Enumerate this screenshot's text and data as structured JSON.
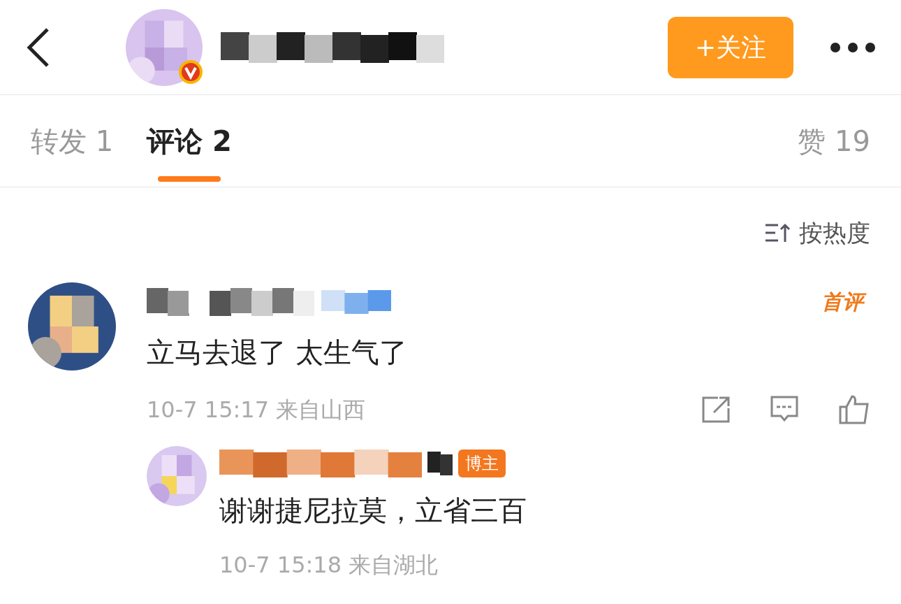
{
  "header": {
    "follow_button": "+关注"
  },
  "tabs": [
    {
      "label": "转发 1",
      "selected": false
    },
    {
      "label": "评论 2",
      "selected": true
    }
  ],
  "likes": "赞 19",
  "sort": "按热度",
  "comments": [
    {
      "badge": "首评",
      "text": "立马去退了 太生气了",
      "meta": "10-7 15:17 来自山西",
      "replies": [
        {
          "tag": "博主",
          "text": "谢谢捷尼拉莫，立省三百",
          "meta": "10-7 15:18 来自湖北"
        }
      ]
    }
  ]
}
